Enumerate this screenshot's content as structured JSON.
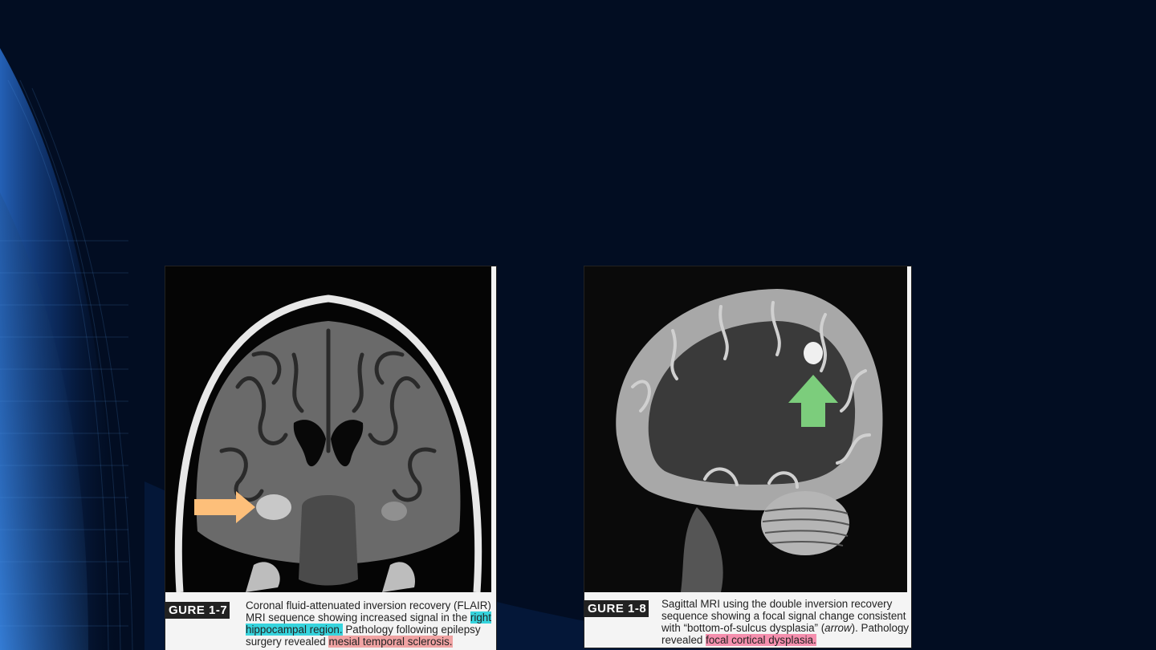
{
  "slide": {
    "background_color": "#020d22",
    "accent_color": "#1a4a9a"
  },
  "figure1": {
    "label": "GURE 1-7",
    "caption_parts": {
      "p1": "Coronal fluid-attenuated inversion recovery (FLAIR) MRI sequence showing increased signal in the ",
      "h1": "right hippocampal region.",
      "p2": " Pathology following epilepsy surgery revealed ",
      "h2": "mesial temporal sclerosis."
    },
    "highlight_colors": [
      "#36d4dd",
      "#f0a3a3"
    ],
    "annotation": {
      "icon": "arrow-right-icon",
      "color": "#fdbf7a"
    }
  },
  "figure2": {
    "label": "GURE 1-8",
    "caption_parts": {
      "p1": "Sagittal MRI using the double inversion recovery sequence showing a focal signal change consistent with “bottom-of-sulcus dysplasia” (",
      "em": "arrow",
      "p2": "). Pathology revealed ",
      "h1": "focal cortical dysplasia."
    },
    "highlight_colors": [
      "#f58fae"
    ],
    "annotation": {
      "icon": "arrow-up-icon",
      "color": "#7ccd7c"
    }
  }
}
